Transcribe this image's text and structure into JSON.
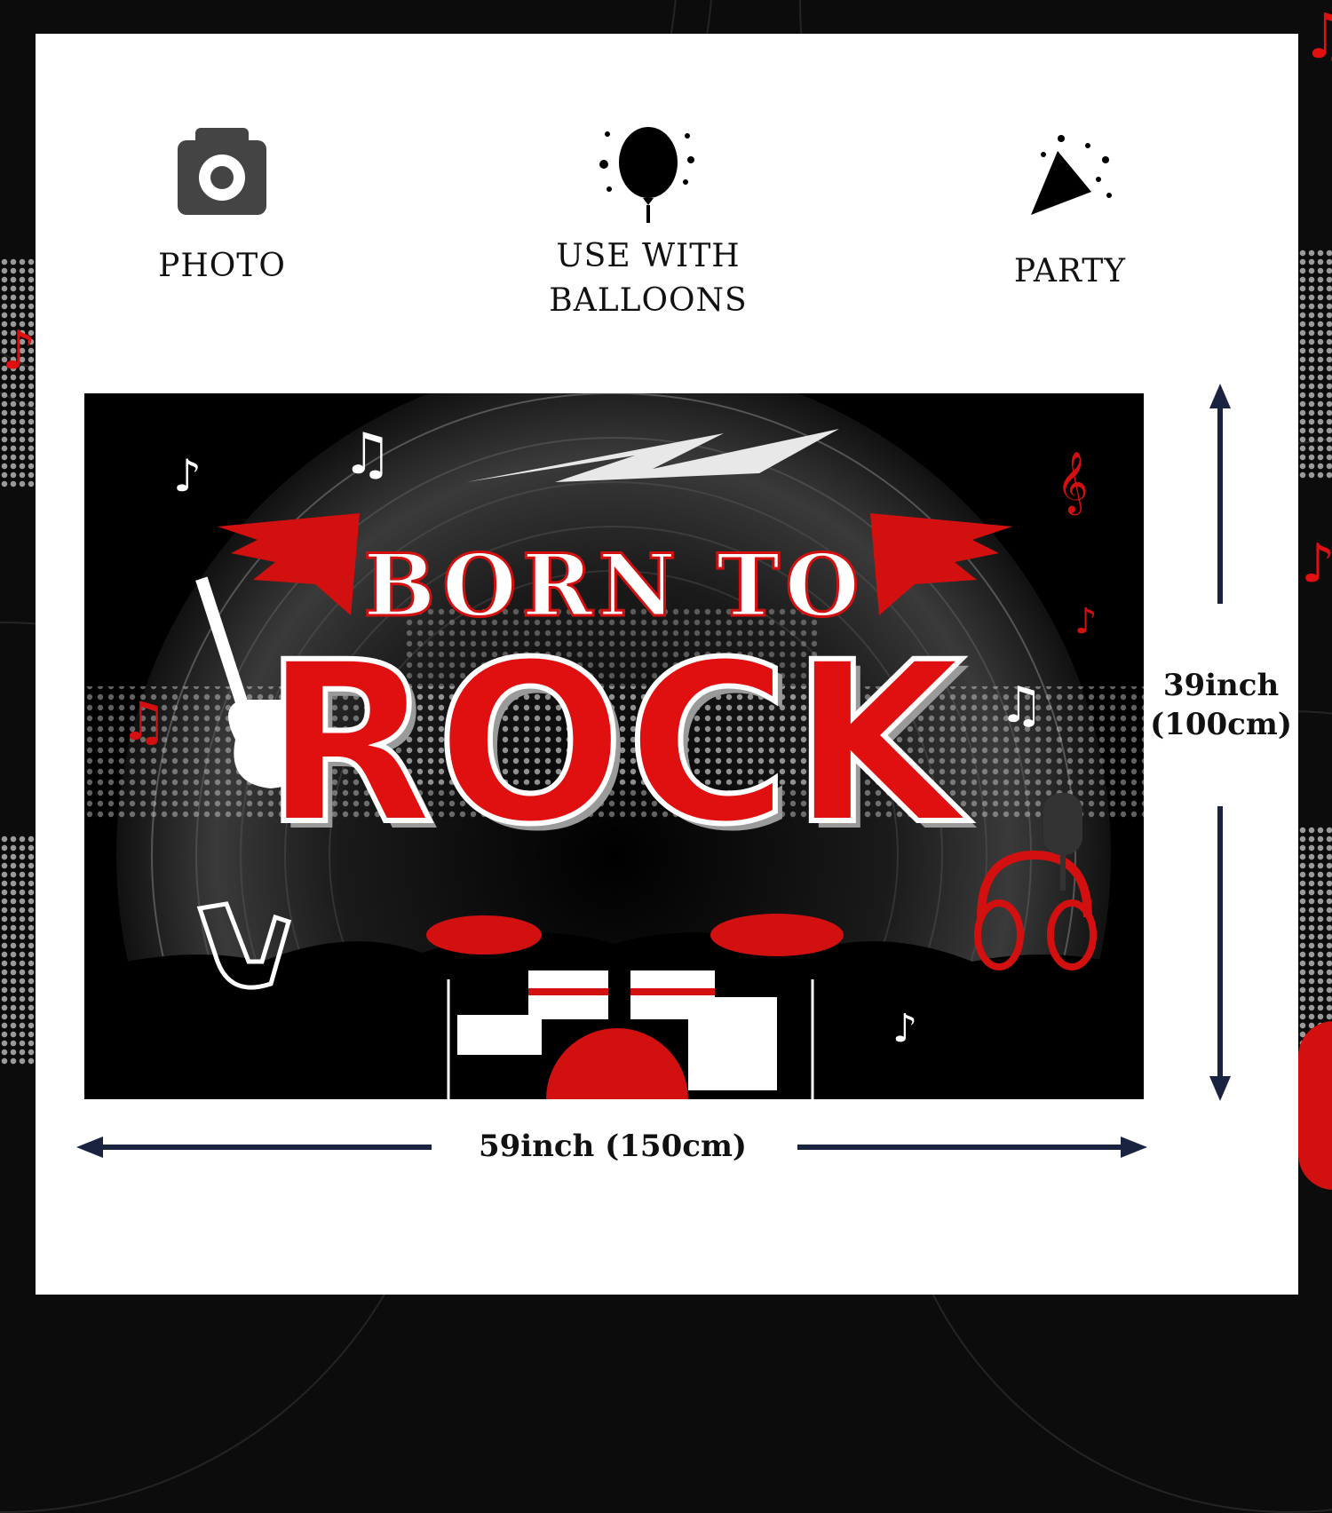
{
  "features": [
    {
      "icon": "camera-icon",
      "label_lines": [
        "PHOTO"
      ]
    },
    {
      "icon": "balloon-icon",
      "label_lines": [
        "USE WITH",
        "BALLOONS"
      ]
    },
    {
      "icon": "party-popper-icon",
      "label_lines": [
        "PARTY"
      ]
    }
  ],
  "banner": {
    "headline_top": "BORN TO",
    "headline_main": "ROCK",
    "colors": {
      "accent": "#e01010",
      "background": "#000000",
      "trim": "#ffffff"
    },
    "decorations": [
      "vinyl-record",
      "wings-icon",
      "guitar-icon",
      "rock-hand-icon",
      "drum-kit",
      "headphones-icon",
      "microphone-icon",
      "music-note-icon",
      "lightning-icon"
    ]
  },
  "dimensions": {
    "width_label": "59inch (150cm)",
    "height_line1": "39inch",
    "height_line2": "(100cm)"
  },
  "colors": {
    "arrow": "#1a2340",
    "text": "#111111"
  }
}
